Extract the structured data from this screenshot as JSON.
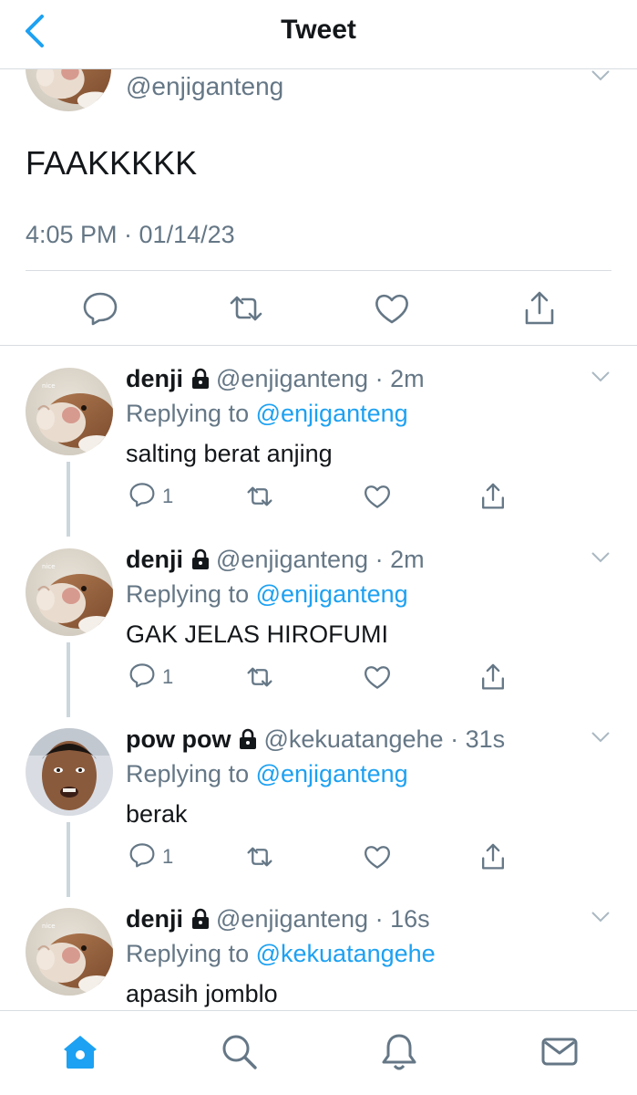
{
  "header": {
    "title": "Tweet",
    "back_icon": "back-chevron-icon"
  },
  "main_tweet": {
    "handle": "@enjiganteng",
    "text": "FAAKKKKK",
    "timestamp": "4:05 PM · 01/14/23",
    "actions": [
      "reply-icon",
      "retweet-icon",
      "like-icon",
      "share-icon"
    ]
  },
  "replies": [
    {
      "name": "denji",
      "handle": "@enjiganteng",
      "dot": "·",
      "time": "2m",
      "replying_prefix": "Replying to",
      "replying_to": "@enjiganteng",
      "text": "salting berat anjing",
      "reply_count": "1",
      "avatar": "hamster-avatar"
    },
    {
      "name": "denji",
      "handle": "@enjiganteng",
      "dot": "·",
      "time": "2m",
      "replying_prefix": "Replying to",
      "replying_to": "@enjiganteng",
      "text": "GAK JELAS HIROFUMI",
      "reply_count": "1",
      "avatar": "hamster-avatar"
    },
    {
      "name": "pow pow",
      "handle": "@kekuatangehe",
      "dot": "·",
      "time": "31s",
      "replying_prefix": "Replying to",
      "replying_to": "@enjiganteng",
      "text": "berak",
      "reply_count": "1",
      "avatar": "person-avatar"
    },
    {
      "name": "denji",
      "handle": "@enjiganteng",
      "dot": "·",
      "time": "16s",
      "replying_prefix": "Replying to",
      "replying_to": "@kekuatangehe",
      "text": "apasih jomblo",
      "avatar": "hamster-avatar"
    }
  ],
  "bottom_nav": {
    "items": [
      "home-icon",
      "search-icon",
      "notifications-icon",
      "messages-icon"
    ],
    "active": "home-icon"
  },
  "colors": {
    "accent": "#1da1f2",
    "secondary_text": "#657786",
    "primary_text": "#14171a",
    "divider": "#d8dde2",
    "thread_line": "#ccd6dd"
  }
}
